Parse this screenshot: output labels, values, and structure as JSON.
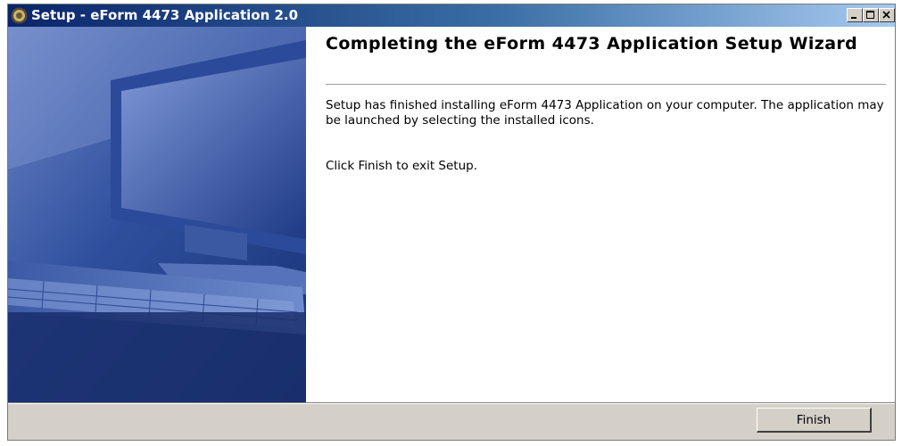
{
  "window": {
    "title": "Setup - eForm 4473 Application 2.0",
    "controls": [
      "minimize",
      "maximize",
      "close"
    ],
    "app_icon": "setup-seal-icon"
  },
  "wizard": {
    "heading": "Completing the eForm 4473 Application Setup Wizard",
    "body": "Setup has finished installing eForm 4473 Application on your computer. The application may be launched by selecting the installed icons.",
    "exit_instruction": "Click Finish to exit Setup."
  },
  "buttons": {
    "finish": "Finish"
  },
  "colors": {
    "titlebar_start": "#0a246a",
    "titlebar_end": "#a6caf0",
    "panel": "#d4d0c8",
    "content_bg": "#ffffff",
    "side_image": "#2a4a96"
  }
}
